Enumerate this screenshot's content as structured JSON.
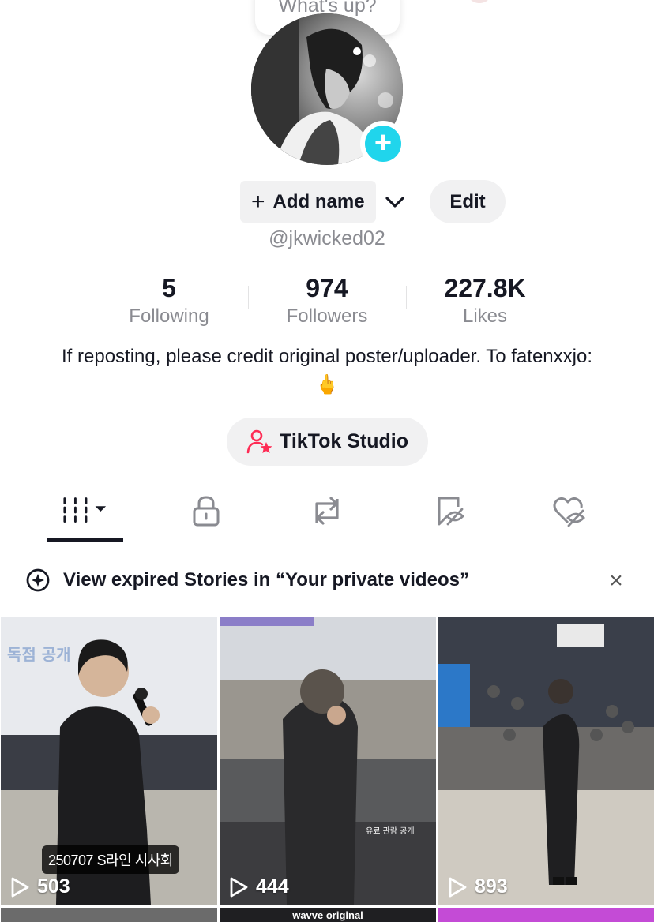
{
  "bubble": {
    "text": "What's up?"
  },
  "profile": {
    "add_name_label": "Add name",
    "add_name_icon": "+",
    "edit_label": "Edit",
    "handle": "@jkwicked02"
  },
  "stats": [
    {
      "value": "5",
      "label": "Following"
    },
    {
      "value": "974",
      "label": "Followers"
    },
    {
      "value": "227.8K",
      "label": "Likes"
    }
  ],
  "bio": "If reposting, please credit original poster/uploader. To fatenxxjo: 🖕",
  "studio": {
    "label": "TikTok Studio",
    "icon": "person-star-icon"
  },
  "tabs": [
    {
      "icon": "grid-icon",
      "active": true
    },
    {
      "icon": "lock-icon",
      "active": false
    },
    {
      "icon": "repost-icon",
      "active": false
    },
    {
      "icon": "bookmark-icon",
      "active": false
    },
    {
      "icon": "liked-icon",
      "active": false
    }
  ],
  "banner": {
    "text": "View expired Stories in “Your private videos”",
    "close": "×"
  },
  "videos": [
    {
      "views": "503",
      "caption": "250707 S라인 시사회"
    },
    {
      "views": "444"
    },
    {
      "views": "893"
    }
  ],
  "bottom_row": {
    "label": "wavve original"
  },
  "colors": {
    "accent": "#fe2c55",
    "teal": "#20d5ec",
    "muted": "#8a8b91",
    "button_bg": "#f1f1f2"
  }
}
